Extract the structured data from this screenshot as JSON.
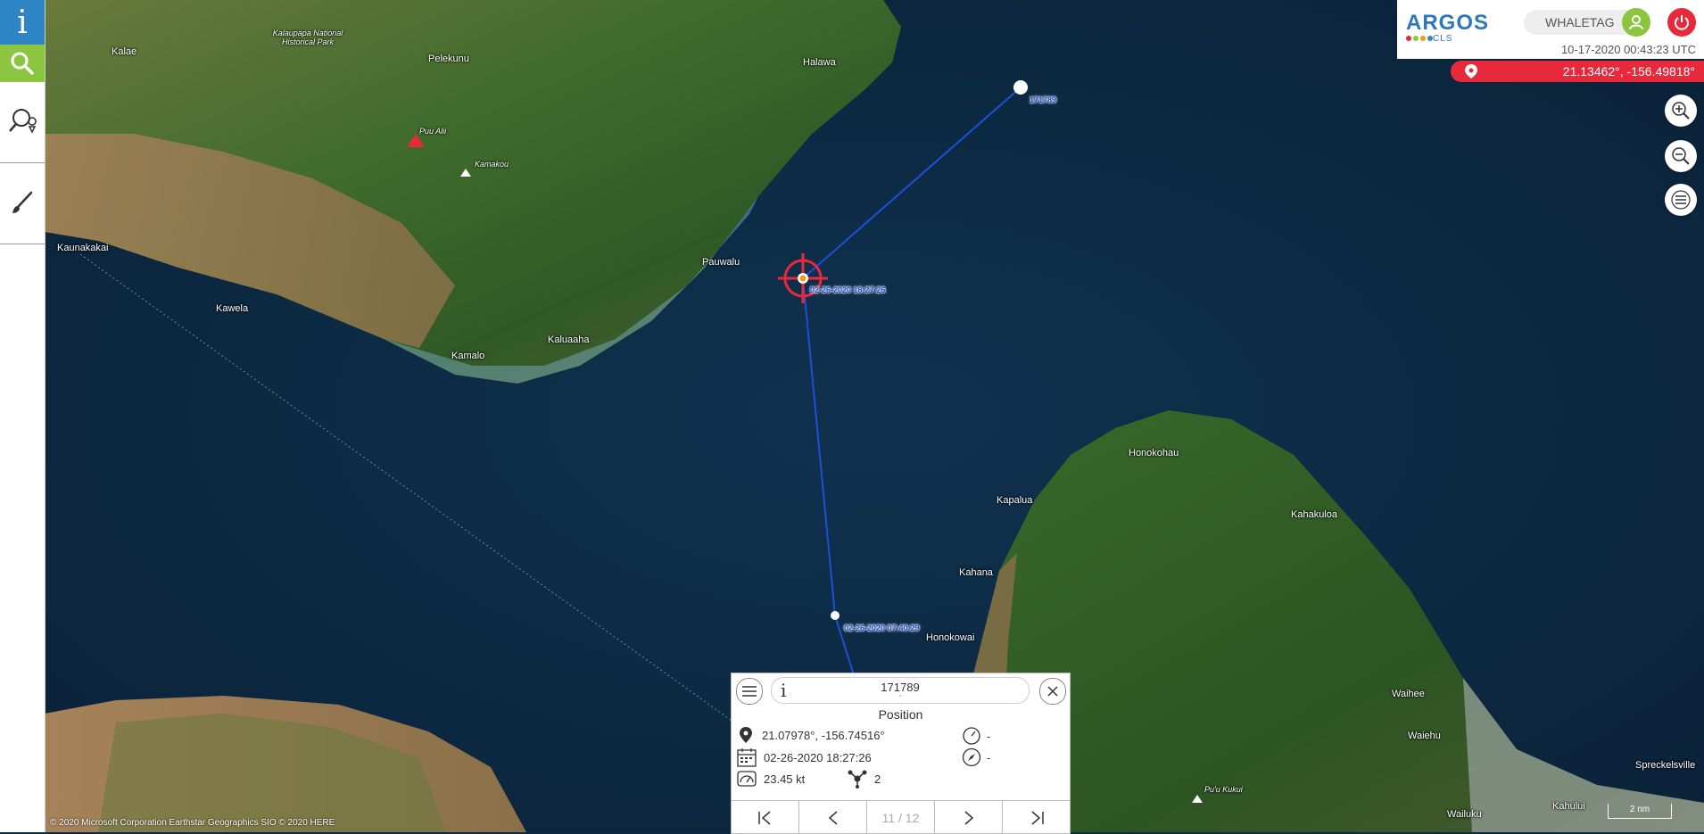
{
  "toolbar": {
    "info_glyph": "i",
    "items": [
      "info",
      "search",
      "search-area",
      "draw"
    ]
  },
  "header": {
    "logo_main": "ARGOS",
    "logo_sub": "CLS",
    "username": "WHALETAG",
    "datetime": "10-17-2020 00:43:23 UTC",
    "cursor_coords": "21.13462°, -156.49818°"
  },
  "map": {
    "place_labels": [
      {
        "text": "Kalae"
      },
      {
        "text": "Pelekunu"
      },
      {
        "text": "Halawa"
      },
      {
        "text": "Kalaupapa National Historical Park"
      },
      {
        "text": "Kaunakakai"
      },
      {
        "text": "Kawela"
      },
      {
        "text": "Kamalo"
      },
      {
        "text": "Kaluaaha"
      },
      {
        "text": "Pauwalu"
      },
      {
        "text": "Puu Alii"
      },
      {
        "text": "Kamakou"
      },
      {
        "text": "Honokohau"
      },
      {
        "text": "Kapalua"
      },
      {
        "text": "Kahakuloa"
      },
      {
        "text": "Kahana"
      },
      {
        "text": "Honokowai"
      },
      {
        "text": "Waihee"
      },
      {
        "text": "Waiehu"
      },
      {
        "text": "Pu'u Kukui"
      },
      {
        "text": "Spreckelsville"
      },
      {
        "text": "Kahului"
      },
      {
        "text": "Wailuku"
      }
    ],
    "track_labels": {
      "start": "171789",
      "selected": "02-26-2020 18:27:26",
      "previous": "02-26-2020 07:40:29"
    },
    "track_color": "#1d4fd8",
    "highlight_color": "#e8293c",
    "attribution": "© 2020 Microsoft Corporation Earthstar Geographics SIO © 2020 HERE",
    "scale_label": "2 nm"
  },
  "popup": {
    "info_glyph": "i",
    "id": "171789",
    "subtitle": "-",
    "section_title": "Position",
    "coords": "21.07978°, -156.74516°",
    "date": "02-26-2020 18:27:26",
    "speed": "23.45 kt",
    "satellites": "2",
    "gauge_value": "-",
    "heading_value": "-",
    "nav": {
      "first": "|<",
      "prev": "<",
      "page": "11 / 12",
      "next": ">",
      "last": ">|"
    }
  },
  "colors": {
    "accent_blue": "#2f84c4",
    "accent_green": "#8cc53f",
    "alert_red": "#e8293c"
  }
}
